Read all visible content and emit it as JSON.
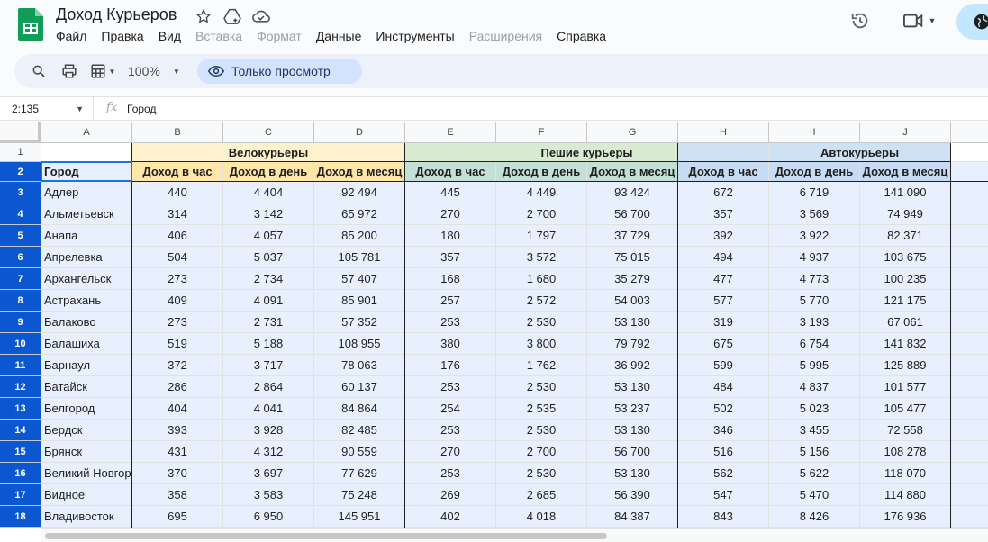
{
  "app": {
    "title": "Доход Курьеров",
    "menu": [
      {
        "label": "Файл",
        "disabled": false
      },
      {
        "label": "Правка",
        "disabled": false
      },
      {
        "label": "Вид",
        "disabled": false
      },
      {
        "label": "Вставка",
        "disabled": true
      },
      {
        "label": "Формат",
        "disabled": true
      },
      {
        "label": "Данные",
        "disabled": false
      },
      {
        "label": "Инструменты",
        "disabled": false
      },
      {
        "label": "Расширения",
        "disabled": true
      },
      {
        "label": "Справка",
        "disabled": false
      }
    ]
  },
  "toolbar": {
    "zoom": "100%",
    "view_only_label": "Только просмотр"
  },
  "formula_bar": {
    "cell_ref": "2:135",
    "content": "Город"
  },
  "columns": [
    "A",
    "B",
    "C",
    "D",
    "E",
    "F",
    "G",
    "H",
    "I",
    "J"
  ],
  "groups": {
    "bike": "Велокурьеры",
    "foot": "Пешие курьеры",
    "auto": "Автокурьеры"
  },
  "header_row": {
    "city": "Город",
    "per_hour": "Доход в час",
    "per_day": "Доход в день",
    "per_month": "Доход в месяц"
  },
  "rows": [
    {
      "num": "3",
      "cells": [
        "Адлер",
        "440",
        "4 404",
        "92 494",
        "445",
        "4 449",
        "93 424",
        "672",
        "6 719",
        "141 090"
      ]
    },
    {
      "num": "4",
      "cells": [
        "Альметьевск",
        "314",
        "3 142",
        "65 972",
        "270",
        "2 700",
        "56 700",
        "357",
        "3 569",
        "74 949"
      ]
    },
    {
      "num": "5",
      "cells": [
        "Анапа",
        "406",
        "4 057",
        "85 200",
        "180",
        "1 797",
        "37 729",
        "392",
        "3 922",
        "82 371"
      ]
    },
    {
      "num": "6",
      "cells": [
        "Апрелевка",
        "504",
        "5 037",
        "105 781",
        "357",
        "3 572",
        "75 015",
        "494",
        "4 937",
        "103 675"
      ]
    },
    {
      "num": "7",
      "cells": [
        "Архангельск",
        "273",
        "2 734",
        "57 407",
        "168",
        "1 680",
        "35 279",
        "477",
        "4 773",
        "100 235"
      ]
    },
    {
      "num": "8",
      "cells": [
        "Астрахань",
        "409",
        "4 091",
        "85 901",
        "257",
        "2 572",
        "54 003",
        "577",
        "5 770",
        "121 175"
      ]
    },
    {
      "num": "9",
      "cells": [
        "Балаково",
        "273",
        "2 731",
        "57 352",
        "253",
        "2 530",
        "53 130",
        "319",
        "3 193",
        "67 061"
      ]
    },
    {
      "num": "10",
      "cells": [
        "Балашиха",
        "519",
        "5 188",
        "108 955",
        "380",
        "3 800",
        "79 792",
        "675",
        "6 754",
        "141 832"
      ]
    },
    {
      "num": "11",
      "cells": [
        "Барнаул",
        "372",
        "3 717",
        "78 063",
        "176",
        "1 762",
        "36 992",
        "599",
        "5 995",
        "125 889"
      ]
    },
    {
      "num": "12",
      "cells": [
        "Батайск",
        "286",
        "2 864",
        "60 137",
        "253",
        "2 530",
        "53 130",
        "484",
        "4 837",
        "101 577"
      ]
    },
    {
      "num": "13",
      "cells": [
        "Белгород",
        "404",
        "4 041",
        "84 864",
        "254",
        "2 535",
        "53 237",
        "502",
        "5 023",
        "105 477"
      ]
    },
    {
      "num": "14",
      "cells": [
        "Бердск",
        "393",
        "3 928",
        "82 485",
        "253",
        "2 530",
        "53 130",
        "346",
        "3 455",
        "72 558"
      ]
    },
    {
      "num": "15",
      "cells": [
        "Брянск",
        "431",
        "4 312",
        "90 559",
        "270",
        "2 700",
        "56 700",
        "516",
        "5 156",
        "108 278"
      ]
    },
    {
      "num": "16",
      "cells": [
        "Великий Новгород",
        "370",
        "3 697",
        "77 629",
        "253",
        "2 530",
        "53 130",
        "562",
        "5 622",
        "118 070"
      ]
    },
    {
      "num": "17",
      "cells": [
        "Видное",
        "358",
        "3 583",
        "75 248",
        "269",
        "2 685",
        "56 390",
        "547",
        "5 470",
        "114 880"
      ]
    },
    {
      "num": "18",
      "cells": [
        "Владивосток",
        "695",
        "6 950",
        "145 951",
        "402",
        "4 018",
        "84 387",
        "843",
        "8 426",
        "176 936"
      ]
    }
  ],
  "colors": {
    "bike_group": "#fdf2cd",
    "foot_group": "#d9ead3",
    "auto_group": "#cfe2f3",
    "bike_sub": "#ffe7a9",
    "foot_sub": "#c4dfd5",
    "auto_sub": "#c7dcf3",
    "selection": "#e8f0fe",
    "accent": "#0b57d0"
  }
}
